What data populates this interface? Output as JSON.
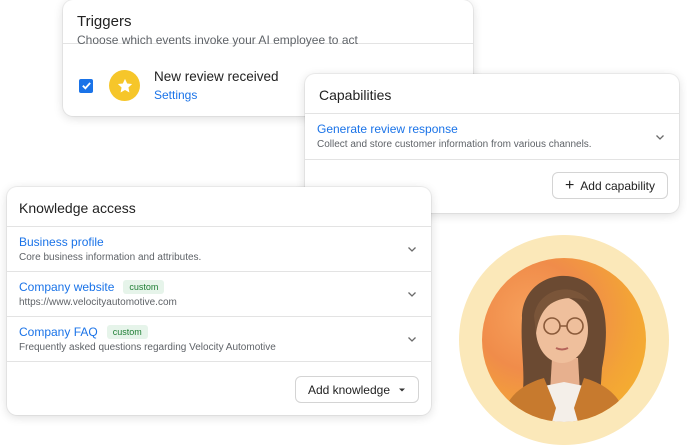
{
  "triggers": {
    "title": "Triggers",
    "subtitle": "Choose which events invoke your AI employee to act",
    "item": {
      "name": "New review received",
      "settings_label": "Settings",
      "checked": true,
      "icon": "star-icon"
    }
  },
  "capabilities": {
    "title": "Capabilities",
    "items": [
      {
        "title": "Generate review response",
        "description": "Collect and store customer information from various channels."
      }
    ],
    "add_button_label": "Add capability"
  },
  "knowledge": {
    "title": "Knowledge access",
    "items": [
      {
        "title": "Business profile",
        "description": "Core business information and attributes.",
        "badge": ""
      },
      {
        "title": "Company website",
        "description": "https://www.velocityautomotive.com",
        "badge": "custom"
      },
      {
        "title": "Company FAQ",
        "description": "Frequently asked questions regarding Velocity Automotive",
        "badge": "custom"
      }
    ],
    "add_button_label": "Add knowledge"
  },
  "colors": {
    "accent": "#1a73e8",
    "star": "#f6c62a",
    "badge_bg": "#e6f4ea",
    "badge_text": "#1e7e34",
    "ring": "#fbe8b9"
  }
}
